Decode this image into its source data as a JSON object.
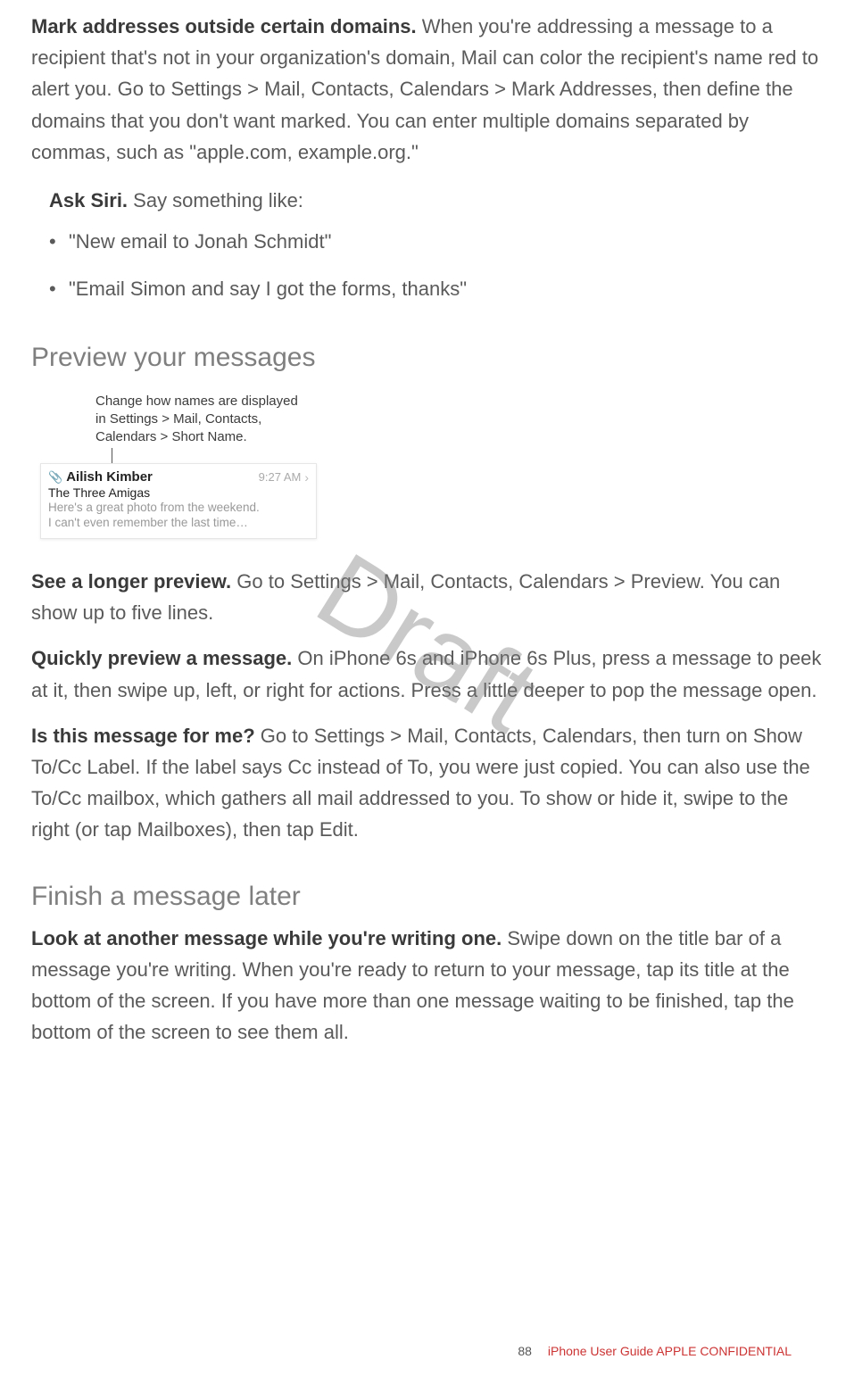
{
  "para_mark": {
    "lead": "Mark addresses outside certain domains.",
    "text": " When you're addressing a message to a recipient that's not in your organization's domain, Mail can color the recipient's name red to alert you. Go to Settings > Mail, Contacts, Calendars > Mark Addresses, then define the domains that you don't want marked. You can enter multiple domains separated by commas, such as \"apple.com, example.org.\""
  },
  "siri": {
    "lead": "Ask Siri.",
    "tail": " Say something like:",
    "items": [
      "\"New email to Jonah Schmidt\"",
      "\"Email Simon and say I got the forms, thanks\""
    ]
  },
  "heading_preview": "Preview your messages",
  "figure": {
    "callout_line1": "Change how names are displayed",
    "callout_line2": "in Settings > Mail, Contacts,",
    "callout_line3": "Calendars > Short Name.",
    "sender": "Ailish Kimber",
    "time": "9:27 AM",
    "subject": "The Three Amigas",
    "preview_l1": "Here's a great photo from the weekend.",
    "preview_l2": "I can't even remember the last time…"
  },
  "para_longer": {
    "lead": "See a longer preview.",
    "text": " Go to Settings > Mail, Contacts, Calendars > Preview. You can show up to five lines."
  },
  "para_quick": {
    "lead": "Quickly preview a message.",
    "text": " On iPhone 6s and iPhone 6s Plus, press a message to peek at it, then swipe up, left, or right for actions. Press a little deeper to pop the message open."
  },
  "para_forme": {
    "lead": "Is this message for me?",
    "text": " Go to Settings > Mail, Contacts, Calendars, then turn on Show To/Cc Label. If the label says Cc instead of To, you were just copied. You can also use the To/Cc mailbox, which gathers all mail addressed to you. To show or hide it, swipe to the right (or tap Mailboxes), then tap Edit."
  },
  "heading_finish": "Finish a message later",
  "para_look": {
    "lead": "Look at another message while you're writing one.",
    "text": " Swipe down on the title bar of a message you're writing. When you're ready to return to your message, tap its title at the bottom of the screen. If you have more than one message waiting to be finished, tap the bottom of the screen to see them all."
  },
  "watermark": "Draft",
  "footer": {
    "page": "88",
    "title": "iPhone User Guide  APPLE CONFIDENTIAL"
  }
}
